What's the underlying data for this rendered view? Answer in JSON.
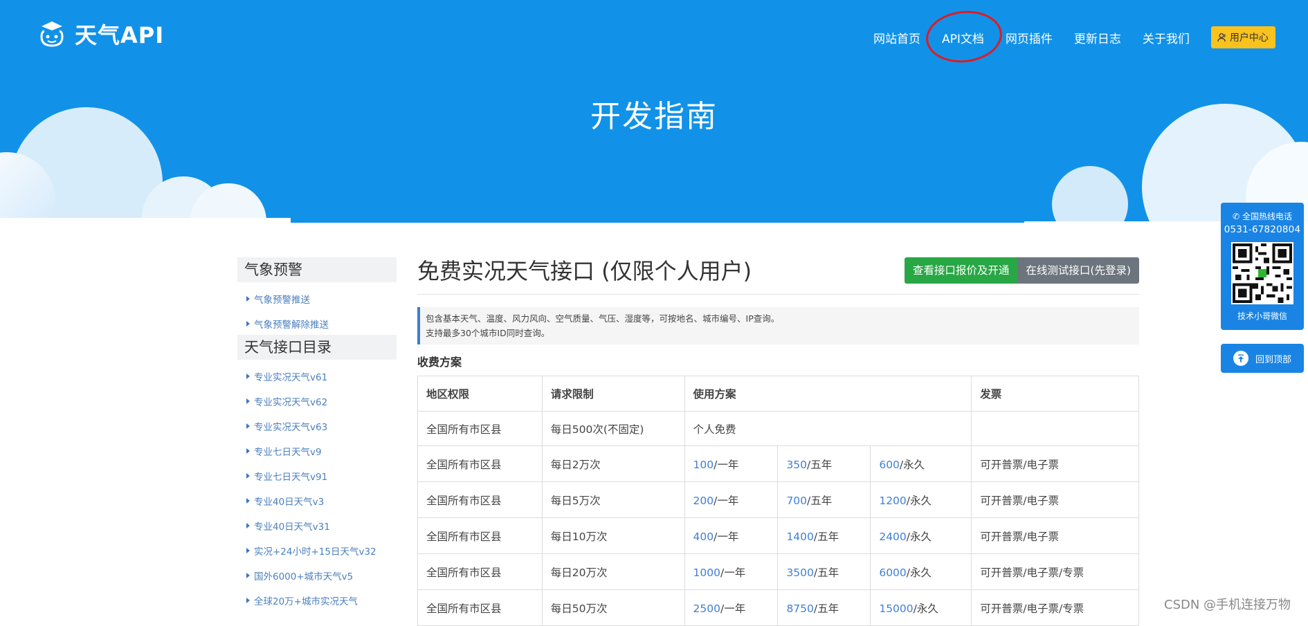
{
  "header": {
    "logo_text": "天气API",
    "nav": [
      {
        "label": "网站首页"
      },
      {
        "label": "API文档"
      },
      {
        "label": "网页插件"
      },
      {
        "label": "更新日志"
      },
      {
        "label": "关于我们"
      }
    ],
    "user_center": "用户中心"
  },
  "hero": {
    "title": "开发指南"
  },
  "sidebar": {
    "sections": [
      {
        "heading": "气象预警",
        "items": [
          "气象预警推送",
          "气象预警解除推送"
        ]
      },
      {
        "heading": "天气接口目录",
        "items": [
          "专业实况天气v61",
          "专业实况天气v62",
          "专业实况天气v63",
          "专业七日天气v9",
          "专业七日天气v91",
          "专业40日天气v3",
          "专业40日天气v31",
          "实况+24小时+15日天气v32",
          "国外6000+城市天气v5",
          "全球20万+城市实况天气"
        ]
      }
    ]
  },
  "main": {
    "title": "免费实况天气接口 (仅限个人用户)",
    "btn_pricing": "查看接口报价及开通",
    "btn_test": "在线测试接口(先登录)",
    "info_line1": "包含基本天气、温度、风力风向、空气质量、气压、湿度等，可按地名、城市编号、IP查询。",
    "info_line2": "支持最多30个城市ID同时查询。",
    "pricing_label": "收费方案",
    "table": {
      "headers": [
        "地区权限",
        "请求限制",
        "使用方案",
        "发票"
      ],
      "free_row": {
        "region": "全国所有市区县",
        "limit": "每日500次(不固定)",
        "plan": "个人免费",
        "invoice": ""
      },
      "rows": [
        {
          "region": "全国所有市区县",
          "limit": "每日2万次",
          "p1": "100",
          "p2": "350",
          "p3": "600",
          "invoice": "可开普票/电子票"
        },
        {
          "region": "全国所有市区县",
          "limit": "每日5万次",
          "p1": "200",
          "p2": "700",
          "p3": "1200",
          "invoice": "可开普票/电子票"
        },
        {
          "region": "全国所有市区县",
          "limit": "每日10万次",
          "p1": "400",
          "p2": "1400",
          "p3": "2400",
          "invoice": "可开普票/电子票"
        },
        {
          "region": "全国所有市区县",
          "limit": "每日20万次",
          "p1": "1000",
          "p2": "3500",
          "p3": "6000",
          "invoice": "可开普票/电子票/专票"
        },
        {
          "region": "全国所有市区县",
          "limit": "每日50万次",
          "p1": "2500",
          "p2": "8750",
          "p3": "15000",
          "invoice": "可开普票/电子票/专票"
        }
      ],
      "unit_1y": "/一年",
      "unit_5y": "/五年",
      "unit_forever": "/永久"
    }
  },
  "float": {
    "hotline_label": "全国热线电话",
    "hotline_number": "0531-67820804",
    "wechat_label": "技术小哥微信",
    "back_to_top": "回到顶部"
  },
  "watermark": "CSDN @手机连接万物",
  "colors": {
    "hero_bg": "#1192e8",
    "user_btn": "#f9c21d",
    "btn_green": "#28a745",
    "btn_grey": "#6c757d",
    "price_link": "#3f7fd6",
    "float_bg": "#1a84e4",
    "annotation_circle": "#e11a22"
  }
}
